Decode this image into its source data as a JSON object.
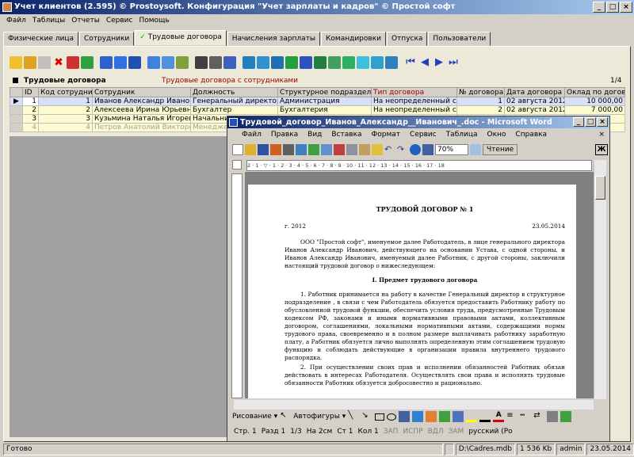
{
  "window": {
    "title": "Учет клиентов (2.595) © Prostoysoft. Конфигурация \"Учет зарплаты и кадров\" © Простой софт"
  },
  "menu": [
    "Файл",
    "Таблицы",
    "Отчеты",
    "Сервис",
    "Помощь"
  ],
  "tabs": [
    {
      "label": "Физические лица"
    },
    {
      "label": "Сотрудники"
    },
    {
      "label": "Трудовые договора",
      "check": "✓"
    },
    {
      "label": "Начисления зарплаты"
    },
    {
      "label": "Командировки"
    },
    {
      "label": "Отпуска"
    },
    {
      "label": "Пользователи"
    }
  ],
  "grid": {
    "title": "Трудовые договора",
    "subtitle": "Трудовые договора с сотрудниками",
    "count": "1/4",
    "columns": [
      "ID",
      "Код сотрудника",
      "Сотрудник",
      "Должность",
      "Структурное подразделение",
      "Тип договора",
      "№ договора",
      "Дата договора",
      "Оклад по договору"
    ],
    "rows": [
      [
        "1",
        "1",
        "Иванов Александр  Иванович",
        "Генеральный директор",
        "Администрация",
        "На неопределенный срок",
        "1",
        "02 августа 2012",
        "10 000,00"
      ],
      [
        "2",
        "2",
        "Алексеева Ирина Юрьевна",
        "Бухгалтер",
        "Бухгалтерия",
        "На неопределенный срок",
        "2",
        "02 августа 2012",
        "7 000,00"
      ],
      [
        "3",
        "3",
        "Кузьмина Наталья Игоревна",
        "Начальник",
        "",
        "",
        "",
        "",
        ""
      ],
      [
        "4",
        "4",
        "Петров Анатолий Викторович",
        "Менеджер",
        "",
        "",
        "",
        "",
        ""
      ]
    ]
  },
  "word": {
    "title": "Трудовой_договор_Иванов_Александр__Иванович_.doc - Microsoft Word",
    "menu": [
      "Файл",
      "Правка",
      "Вид",
      "Вставка",
      "Формат",
      "Сервис",
      "Таблица",
      "Окно",
      "Справка"
    ],
    "zoom": "70%",
    "reading": "Чтение",
    "ruler": "2 · 1 · ▽ · 1 · 2 · 3 · 4 · 5 · 6 · 7 · 8 · 9 · 10 · 11 · 12 · 13 · 14 · 15 · 16 · 17 · 18",
    "doc": {
      "heading": "ТРУДОВОЙ ДОГОВОР № 1",
      "place": "г. 2012",
      "date": "23.05.2014",
      "p1": "ООО \"Простой софт\", именуемое далее Работодатель, в лице генерального директора Иванов Александр  Иванович, действующего на основании Устава, с одной стороны, и Иванов Александр  Иванович, именуемый далее Работник, с другой стороны, заключили настоящий трудовой договор о нижеследующем:",
      "section": "I. Предмет трудового договора",
      "p2": "1. Работник принимается на работу в качестве Генеральный директор в структурное подразделение , в связи с чем Работодатель обязуется предоставить Работнику работу по обусловленной трудовой функции, обеспечить условия труда, предусмотренные Трудовым кодексом РФ, законами и иными нормативными правовыми актами, коллективным договором, соглашениями, локальными нормативными актами, содержащими нормы трудового права, своевременно и в полном размере выплачивать работнику заработную плату, а Работник обязуется лично выполнять определенную этим соглашением трудовую функцию и соблюдать действующие в организации правила внутреннего трудового распорядка.",
      "p3": "2. При осуществлении своих прав и исполнении обязанностей Работник обязан действовать в интересах Работодателя. Осуществлять свои права и исполнять трудовые обязанности Работник обязуется добросовестно и рационально."
    },
    "draw": {
      "label": "Рисование ▾",
      "autoshapes": "Автофигуры ▾"
    },
    "status": [
      "Стр.  1",
      "Разд  1",
      "1/3",
      "На  2см",
      "Ст  1",
      "Кол  1",
      "ЗАП",
      "ИСПР",
      "ВДЛ",
      "ЗАМ",
      "русский (Ро"
    ]
  },
  "statusbar": {
    "ready": "Готово",
    "db": "D:\\Cadres.mdb",
    "size": "1 536 Kb",
    "user": "admin",
    "date": "23.05.2014"
  }
}
